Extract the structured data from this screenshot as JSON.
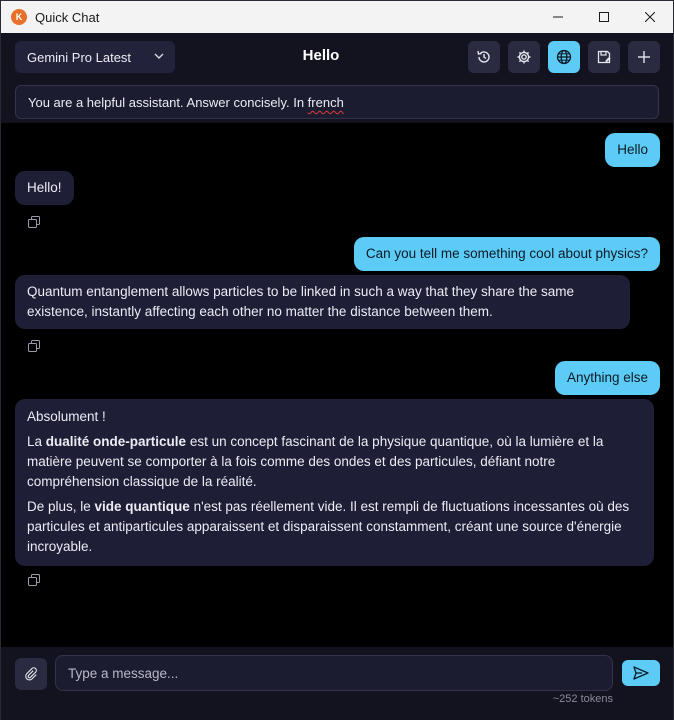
{
  "window": {
    "title": "Quick Chat",
    "icon": "app-logo-icon"
  },
  "header": {
    "model": "Gemini Pro Latest",
    "title": "Hello",
    "buttons": [
      "history-icon",
      "gear-icon",
      "globe-icon",
      "save-icon",
      "plus-icon"
    ],
    "active_color": "#5ccbf5"
  },
  "system_prompt": {
    "text_before": "You are a helpful assistant. Answer concisely. In ",
    "text_misspelled": "french"
  },
  "messages": [
    {
      "role": "user",
      "text": "Hello"
    },
    {
      "role": "assistant",
      "text": "Hello!"
    },
    {
      "role": "user",
      "text": "Can you tell me something cool about physics?"
    },
    {
      "role": "assistant",
      "text": "Quantum entanglement allows particles to be linked in such a way that they share the same existence, instantly affecting each other no matter the distance between them."
    },
    {
      "role": "user",
      "text": "Anything else"
    },
    {
      "role": "assistant",
      "p1": "Absolument !",
      "p2_a": "La ",
      "p2_bold": "dualité onde-particule",
      "p2_b": " est un concept fascinant de la physique quantique, où la lumière et la matière peuvent se comporter à la fois comme des ondes et des particules, défiant notre compréhension classique de la réalité.",
      "p3_a": "De plus, le ",
      "p3_bold": "vide quantique",
      "p3_b": " n'est pas réellement vide. Il est rempli de fluctuations incessantes où des particules et antiparticules apparaissent et disparaissent constamment, créant une source d'énergie incroyable."
    }
  ],
  "input": {
    "placeholder": "Type a message...",
    "value": ""
  },
  "token_count": "~252 tokens"
}
